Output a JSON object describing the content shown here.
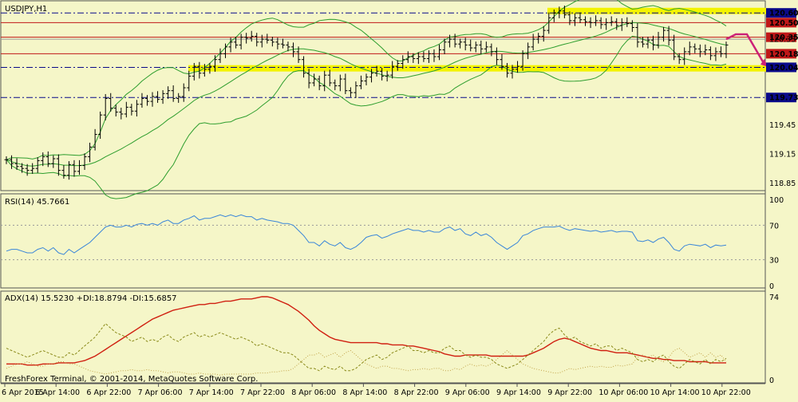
{
  "colors": {
    "background": "#f5f6c8",
    "candle": "#000000",
    "bollinger": "#2e9e2e",
    "rsi_line": "#3a86d9",
    "adx_line": "#d01f10",
    "plus_di": "#8a8a1a",
    "minus_di": "#c2a44a",
    "support_highlight": "#f3f300",
    "blue_level": "#0a0a8a",
    "red_level": "#c01818",
    "arrow": "#cc2277"
  },
  "chart_data": [
    {
      "type": "candlestick",
      "title": "USDJPY,H1",
      "ylim": [
        118.78,
        120.7
      ],
      "ytick_labels": [
        "120.60",
        "120.50",
        "120.35",
        "120.33",
        "120.18",
        "120.04",
        "119.73",
        "119.45",
        "119.15",
        "118.85"
      ],
      "x_tick_labels": [
        "6 Apr 2015",
        "6 Apr 14:00",
        "6 Apr 22:00",
        "7 Apr 06:00",
        "7 Apr 14:00",
        "7 Apr 22:00",
        "8 Apr 06:00",
        "8 Apr 14:00",
        "8 Apr 22:00",
        "9 Apr 06:00",
        "9 Apr 14:00",
        "9 Apr 22:00",
        "10 Apr 06:00",
        "10 Apr 14:00",
        "10 Apr 22:00"
      ],
      "close": [
        119.09,
        119.05,
        119.02,
        119.0,
        118.98,
        119.0,
        119.08,
        119.12,
        119.05,
        119.1,
        118.98,
        118.93,
        119.04,
        118.97,
        119.03,
        119.12,
        119.22,
        119.35,
        119.55,
        119.72,
        119.62,
        119.58,
        119.56,
        119.63,
        119.59,
        119.66,
        119.72,
        119.69,
        119.74,
        119.71,
        119.77,
        119.8,
        119.72,
        119.74,
        119.83,
        119.95,
        120.05,
        119.98,
        120.02,
        120.05,
        120.12,
        120.18,
        120.25,
        120.3,
        120.27,
        120.35,
        120.34,
        120.36,
        120.3,
        120.33,
        120.32,
        120.3,
        120.28,
        120.27,
        120.25,
        120.2,
        120.12,
        119.98,
        119.88,
        119.92,
        119.85,
        119.96,
        119.88,
        119.85,
        119.92,
        119.8,
        119.78,
        119.85,
        119.9,
        119.94,
        119.98,
        120.0,
        119.95,
        119.96,
        120.05,
        120.08,
        120.12,
        120.15,
        120.13,
        120.15,
        120.13,
        120.18,
        120.15,
        120.22,
        120.3,
        120.33,
        120.28,
        120.3,
        120.27,
        120.24,
        120.27,
        120.23,
        120.25,
        120.2,
        120.12,
        120.05,
        119.98,
        120.02,
        120.05,
        120.18,
        120.25,
        120.33,
        120.36,
        120.42,
        120.55,
        120.6,
        120.62,
        120.58,
        120.52,
        120.55,
        120.53,
        120.51,
        120.5,
        120.52,
        120.48,
        120.5,
        120.51,
        120.47,
        120.5,
        120.49,
        120.45,
        120.3,
        120.28,
        120.32,
        120.27,
        120.35,
        120.42,
        120.32,
        120.15,
        120.12,
        120.2,
        120.25,
        120.23,
        120.2,
        120.22,
        120.16,
        120.2,
        120.18,
        120.27
      ],
      "bollinger_bands": {
        "period": 20
      },
      "levels": [
        {
          "label": "120.60",
          "value": 120.6,
          "style": "blue-dashdot"
        },
        {
          "label": "120.50",
          "value": 120.5,
          "style": "red"
        },
        {
          "label": "120.35",
          "value": 120.35,
          "style": "red"
        },
        {
          "label": "120.33",
          "value": 120.33,
          "style": "grey"
        },
        {
          "label": "120.18",
          "value": 120.18,
          "style": "red"
        },
        {
          "label": "120.04",
          "value": 120.04,
          "style": "blue-dashdot"
        },
        {
          "label": "119.73",
          "value": 119.73,
          "style": "blue-dashdot"
        }
      ],
      "highlight_zones": [
        {
          "value": 120.62
        },
        {
          "value": 120.03
        }
      ],
      "forecast_arrow": {
        "from": 120.33,
        "peak": 120.38,
        "to": 120.07
      }
    },
    {
      "type": "line",
      "title": "RSI(14) 45.7661",
      "ylim": [
        0,
        100
      ],
      "ytick_labels": [
        "100",
        "70",
        "30",
        "0"
      ],
      "levels": [
        70,
        30
      ],
      "values": [
        40,
        42,
        42,
        40,
        38,
        38,
        42,
        44,
        40,
        44,
        38,
        36,
        42,
        38,
        42,
        46,
        50,
        56,
        62,
        68,
        70,
        68,
        68,
        70,
        68,
        71,
        72,
        70,
        72,
        70,
        74,
        76,
        72,
        72,
        76,
        78,
        81,
        76,
        78,
        78,
        80,
        82,
        80,
        82,
        80,
        82,
        80,
        80,
        76,
        78,
        76,
        75,
        74,
        72,
        72,
        70,
        64,
        58,
        50,
        50,
        46,
        52,
        48,
        46,
        50,
        44,
        42,
        45,
        50,
        56,
        58,
        59,
        55,
        57,
        60,
        62,
        64,
        66,
        64,
        64,
        62,
        64,
        62,
        62,
        66,
        68,
        64,
        66,
        60,
        58,
        62,
        58,
        60,
        56,
        50,
        46,
        42,
        46,
        50,
        58,
        60,
        64,
        66,
        68,
        68,
        68,
        69,
        66,
        64,
        66,
        65,
        64,
        63,
        64,
        62,
        63,
        64,
        62,
        63,
        63,
        62,
        52,
        51,
        53,
        50,
        54,
        56,
        50,
        42,
        40,
        46,
        48,
        47,
        46,
        48,
        44,
        47,
        46,
        47
      ]
    },
    {
      "type": "line",
      "title": "ADX(14) 15.5230 +DI:18.8794 -DI:15.6857",
      "ylim": [
        0,
        74
      ],
      "ytick_labels": [
        "74",
        "0"
      ],
      "series": [
        {
          "name": "ADX(14)",
          "values": [
            14,
            14,
            14,
            14,
            13,
            13,
            13,
            14,
            14,
            14,
            15,
            15,
            15,
            15,
            16,
            17,
            19,
            21,
            24,
            27,
            30,
            33,
            36,
            39,
            42,
            45,
            48,
            51,
            54,
            56,
            58,
            60,
            62,
            63,
            64,
            65,
            66,
            67,
            67,
            68,
            68,
            69,
            70,
            70,
            71,
            72,
            72,
            72,
            73,
            74,
            74,
            73,
            71,
            69,
            67,
            64,
            61,
            57,
            53,
            48,
            44,
            41,
            38,
            36,
            35,
            34,
            33,
            33,
            33,
            33,
            33,
            33,
            32,
            32,
            31,
            31,
            31,
            30,
            30,
            29,
            28,
            27,
            26,
            25,
            23,
            22,
            21,
            21,
            22,
            22,
            22,
            22,
            22,
            21,
            21,
            21,
            21,
            21,
            21,
            21,
            22,
            24,
            26,
            28,
            31,
            34,
            36,
            37,
            36,
            34,
            32,
            30,
            28,
            27,
            26,
            26,
            25,
            24,
            24,
            24,
            23,
            22,
            21,
            20,
            19,
            19,
            18,
            18,
            17,
            17,
            17,
            16,
            16,
            16,
            16,
            15,
            15,
            15,
            15
          ]
        },
        {
          "name": "+DI:18.8794",
          "values": [
            28,
            26,
            24,
            22,
            20,
            22,
            24,
            26,
            24,
            22,
            20,
            20,
            24,
            22,
            26,
            30,
            34,
            38,
            44,
            50,
            46,
            42,
            40,
            38,
            34,
            36,
            38,
            34,
            36,
            34,
            38,
            40,
            36,
            34,
            38,
            40,
            42,
            38,
            40,
            38,
            40,
            42,
            40,
            38,
            36,
            38,
            36,
            34,
            30,
            32,
            30,
            28,
            26,
            24,
            24,
            22,
            18,
            14,
            10,
            10,
            8,
            12,
            10,
            9,
            12,
            8,
            8,
            10,
            14,
            18,
            20,
            22,
            18,
            20,
            24,
            26,
            28,
            30,
            26,
            26,
            24,
            26,
            24,
            24,
            28,
            30,
            26,
            26,
            22,
            20,
            22,
            20,
            20,
            18,
            14,
            12,
            10,
            12,
            14,
            18,
            22,
            26,
            30,
            34,
            40,
            44,
            46,
            40,
            36,
            38,
            34,
            32,
            30,
            32,
            28,
            30,
            30,
            26,
            28,
            26,
            24,
            18,
            16,
            18,
            16,
            20,
            22,
            16,
            12,
            10,
            14,
            18,
            16,
            14,
            18,
            14,
            18,
            16,
            19
          ]
        },
        {
          "name": "-DI:15.6857",
          "values": [
            10,
            12,
            14,
            14,
            16,
            14,
            12,
            12,
            14,
            14,
            16,
            16,
            14,
            14,
            12,
            10,
            8,
            7,
            6,
            5,
            6,
            7,
            8,
            8,
            9,
            8,
            8,
            9,
            8,
            8,
            7,
            6,
            7,
            7,
            6,
            5,
            5,
            6,
            5,
            5,
            5,
            4,
            5,
            5,
            5,
            5,
            5,
            5,
            6,
            6,
            6,
            7,
            7,
            8,
            8,
            10,
            14,
            18,
            22,
            22,
            24,
            20,
            22,
            24,
            20,
            24,
            26,
            22,
            18,
            14,
            12,
            10,
            12,
            12,
            10,
            10,
            9,
            8,
            9,
            9,
            10,
            9,
            10,
            10,
            8,
            8,
            10,
            9,
            12,
            14,
            12,
            13,
            12,
            14,
            18,
            22,
            26,
            22,
            18,
            14,
            12,
            10,
            9,
            8,
            7,
            6,
            6,
            8,
            10,
            9,
            10,
            11,
            12,
            11,
            12,
            11,
            11,
            13,
            12,
            13,
            14,
            20,
            22,
            20,
            22,
            18,
            16,
            20,
            26,
            28,
            24,
            20,
            22,
            24,
            20,
            24,
            20,
            22,
            16
          ]
        }
      ]
    }
  ],
  "footer": {
    "copyright": "FreshForex Terminal, © 2001-2014, MetaQuotes Software Corp."
  }
}
